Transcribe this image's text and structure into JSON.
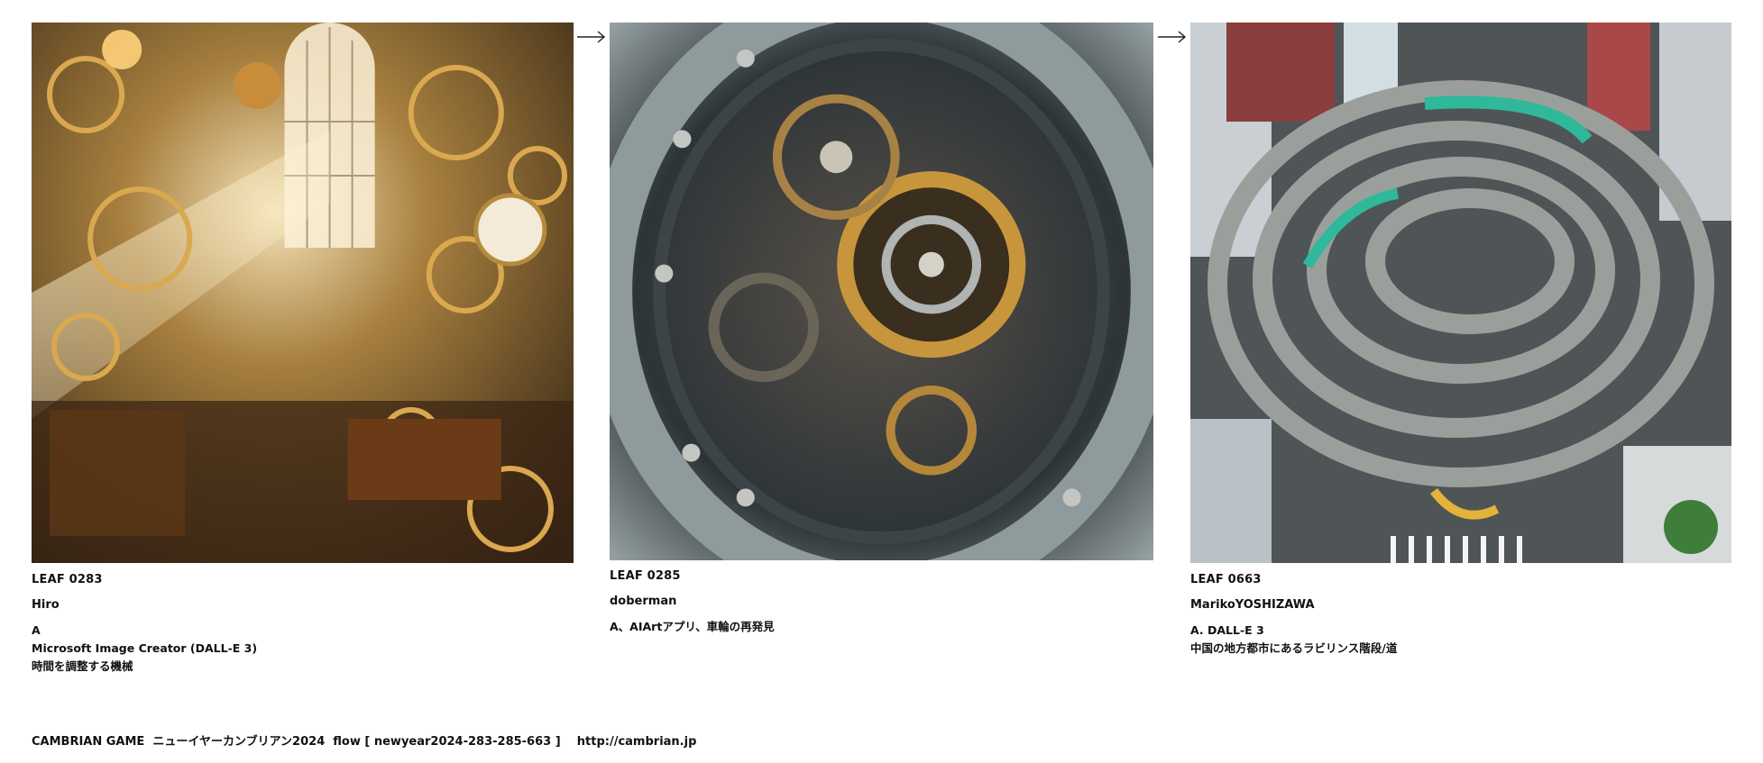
{
  "leaves": [
    {
      "id": "LEAF 0283",
      "author": "Hiro",
      "answer_lines": [
        "A",
        "Microsoft Image Creator (DALL-E 3)",
        "時間を調整する機械"
      ],
      "image": "steampunk-clockwork-workshop"
    },
    {
      "id": "LEAF 0285",
      "author": "doberman",
      "answer_lines": [
        "A、AIArtアプリ、車輪の再発見"
      ],
      "image": "mechanical-gear-wheel-closeup"
    },
    {
      "id": "LEAF 0663",
      "author": "MarikoYOSHIZAWA",
      "answer_lines": [
        "A. DALL-E 3",
        "中国の地方都市にあるラビリンス階段/道"
      ],
      "image": "spiral-labyrinth-walkway-city"
    }
  ],
  "arrows": [
    "arrow-right-icon",
    "arrow-right-icon"
  ],
  "footer": {
    "text": "CAMBRIAN GAME  ニューイヤーカンブリアン2024  flow [ newyear2024-283-285-663 ]    http://cambrian.jp"
  }
}
